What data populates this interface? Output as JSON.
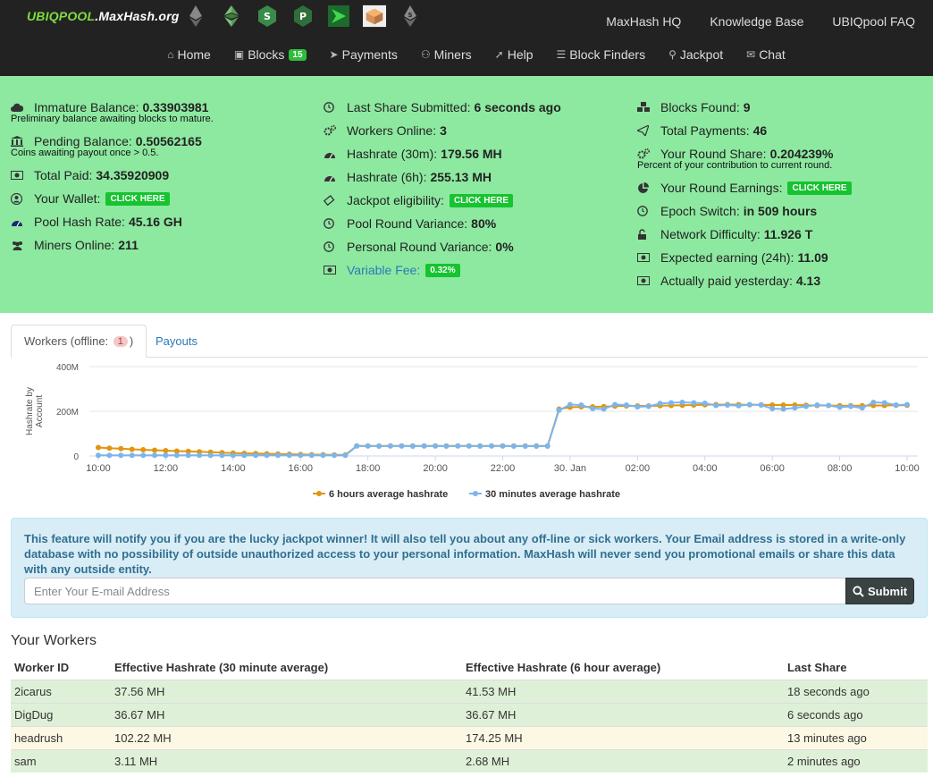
{
  "brand": {
    "prefix": "UBIQPOOL",
    "suffix": ".MaxHash.org"
  },
  "coins": [
    "ethereum-icon",
    "ethereum-classic-icon",
    "s-coin-icon",
    "p-coin-icon",
    "rocket-coin-icon",
    "cube-coin-icon",
    "s-ethereum-icon"
  ],
  "top_links": [
    "MaxHash HQ",
    "Knowledge Base",
    "UBIQpool FAQ"
  ],
  "nav": {
    "home": "Home",
    "blocks": "Blocks",
    "blocks_badge": "15",
    "payments": "Payments",
    "miners": "Miners",
    "help": "Help",
    "block_finders": "Block Finders",
    "jackpot": "Jackpot",
    "chat": "Chat"
  },
  "stats": {
    "immature_label": "Immature Balance:",
    "immature_value": "0.33903981",
    "immature_note": "Preliminary balance awaiting blocks to mature.",
    "pending_label": "Pending Balance:",
    "pending_value": "0.50562165",
    "pending_note": "Coins awaiting payout once > 0.5.",
    "total_paid_label": "Total Paid:",
    "total_paid_value": "34.35920909",
    "wallet_label": "Your Wallet:",
    "click_here": "CLICK HERE",
    "pool_hash_label": "Pool Hash Rate:",
    "pool_hash_value": "45.16 GH",
    "miners_online_label": "Miners Online:",
    "miners_online_value": "211",
    "last_share_label": "Last Share Submitted:",
    "last_share_value": "6 seconds ago",
    "workers_online_label": "Workers Online:",
    "workers_online_value": "3",
    "hash30_label": "Hashrate (30m):",
    "hash30_value": "179.56 MH",
    "hash6_label": "Hashrate (6h):",
    "hash6_value": "255.13 MH",
    "jackpot_label": "Jackpot eligibility:",
    "pool_variance_label": "Pool Round Variance:",
    "pool_variance_value": "80%",
    "personal_variance_label": "Personal Round Variance:",
    "personal_variance_value": "0%",
    "variable_fee_label": "Variable Fee:",
    "variable_fee_value": "0.32%",
    "blocks_found_label": "Blocks Found:",
    "blocks_found_value": "9",
    "total_payments_label": "Total Payments:",
    "total_payments_value": "46",
    "round_share_label": "Your Round Share:",
    "round_share_value": "0.204239%",
    "round_share_note": "Percent of your contribution to current round.",
    "round_earnings_label": "Your Round Earnings:",
    "epoch_label": "Epoch Switch:",
    "epoch_value": "in 509 hours",
    "difficulty_label": "Network Difficulty:",
    "difficulty_value": "11.926 T",
    "expected_label": "Expected earning (24h):",
    "expected_value": "11.09",
    "paid_yesterday_label": "Actually paid yesterday:",
    "paid_yesterday_value": "4.13"
  },
  "tabs": {
    "workers_prefix": "Workers (offline:",
    "offline_count": "1",
    "workers_suffix": ")",
    "payouts": "Payouts"
  },
  "chart_data": {
    "type": "line",
    "ylabel": "Hashrate by Account",
    "ylim": [
      0,
      400
    ],
    "y_ticks": [
      "0",
      "200M",
      "400M"
    ],
    "x_ticks": [
      "10:00",
      "12:00",
      "14:00",
      "16:00",
      "18:00",
      "20:00",
      "22:00",
      "30. Jan",
      "02:00",
      "04:00",
      "06:00",
      "08:00",
      "10:00"
    ],
    "x_start_hour": 10,
    "x_span_hours": 24,
    "colors": {
      "h6": "#e0960e",
      "m30": "#7cb5ec"
    },
    "series": [
      {
        "name": "6 hours average hashrate",
        "key": "h6",
        "x": [
          0,
          0.33,
          0.67,
          1,
          1.33,
          1.67,
          2,
          2.33,
          2.67,
          3,
          3.33,
          3.67,
          4,
          4.33,
          4.67,
          5,
          5.33,
          5.67,
          6,
          6.33,
          6.67,
          7,
          7.33,
          7.67,
          8,
          8.33,
          8.67,
          9,
          9.33,
          9.67,
          10,
          10.33,
          10.67,
          11,
          11.33,
          11.67,
          12,
          12.33,
          12.67,
          13,
          13.33,
          13.67,
          14,
          14.33,
          14.67,
          15,
          15.33,
          15.67,
          16,
          16.33,
          16.67,
          17,
          17.33,
          17.67,
          18,
          18.33,
          18.67,
          19,
          19.33,
          19.67,
          20,
          20.33,
          20.67,
          21,
          21.33,
          21.67,
          22,
          22.33,
          22.67,
          23,
          23.33,
          23.67,
          24
        ],
        "y": [
          38,
          35,
          33,
          30,
          28,
          26,
          24,
          22,
          21,
          19,
          17,
          15,
          13,
          12,
          11,
          10,
          9,
          8,
          7,
          6,
          6,
          5,
          5,
          45,
          45,
          45,
          45,
          45,
          45,
          45,
          45,
          45,
          45,
          45,
          45,
          45,
          45,
          45,
          45,
          45,
          45,
          210,
          218,
          220,
          220,
          221,
          223,
          224,
          224,
          224,
          225,
          226,
          227,
          228,
          229,
          230,
          230,
          230,
          229,
          229,
          228,
          228,
          228,
          227,
          226,
          226,
          225,
          225,
          225,
          226,
          226,
          227,
          227
        ]
      },
      {
        "name": "30 minutes average hashrate",
        "key": "m30",
        "x": [
          0,
          0.33,
          0.67,
          1,
          1.33,
          1.67,
          2,
          2.33,
          2.67,
          3,
          3.33,
          3.67,
          4,
          4.33,
          4.67,
          5,
          5.33,
          5.67,
          6,
          6.33,
          6.67,
          7,
          7.33,
          7.67,
          8,
          8.33,
          8.67,
          9,
          9.33,
          9.67,
          10,
          10.33,
          10.67,
          11,
          11.33,
          11.67,
          12,
          12.33,
          12.67,
          13,
          13.33,
          13.67,
          14,
          14.33,
          14.67,
          15,
          15.33,
          15.67,
          16,
          16.33,
          16.67,
          17,
          17.33,
          17.67,
          18,
          18.33,
          18.67,
          19,
          19.33,
          19.67,
          20,
          20.33,
          20.67,
          21,
          21.33,
          21.67,
          22,
          22.33,
          22.67,
          23,
          23.33,
          23.67,
          24
        ],
        "y": [
          3,
          3,
          3,
          3,
          3,
          3,
          3,
          3,
          3,
          3,
          3,
          3,
          3,
          3,
          3,
          3,
          3,
          3,
          3,
          3,
          3,
          3,
          3,
          45,
          45,
          44,
          45,
          45,
          44,
          45,
          45,
          44,
          45,
          45,
          44,
          45,
          45,
          44,
          44,
          44,
          44,
          205,
          230,
          228,
          212,
          210,
          230,
          228,
          220,
          222,
          235,
          238,
          240,
          238,
          236,
          226,
          228,
          225,
          230,
          228,
          212,
          210,
          215,
          222,
          228,
          226,
          218,
          222,
          215,
          240,
          238,
          228,
          230
        ]
      }
    ]
  },
  "alert": {
    "text": "This feature will notify you if you are the lucky jackpot winner! It will also tell you about any off-line or sick workers. Your Email address is stored in a write-only database with no possibility of outside unauthorized access to your personal information. MaxHash will never send you promotional emails or share this data with any outside entity.",
    "placeholder": "Enter Your E-mail Address",
    "submit": "Submit"
  },
  "workers": {
    "title": "Your Workers",
    "headers": [
      "Worker ID",
      "Effective Hashrate (30 minute average)",
      "Effective Hashrate (6 hour average)",
      "Last Share"
    ],
    "rows": [
      [
        "2icarus",
        "37.56 MH",
        "41.53 MH",
        "18 seconds ago"
      ],
      [
        "DigDug",
        "36.67 MH",
        "36.67 MH",
        "6 seconds ago"
      ],
      [
        "headrush",
        "102.22 MH",
        "174.25 MH",
        "13 minutes ago"
      ],
      [
        "sam",
        "3.11 MH",
        "2.68 MH",
        "2 minutes ago"
      ]
    ]
  }
}
